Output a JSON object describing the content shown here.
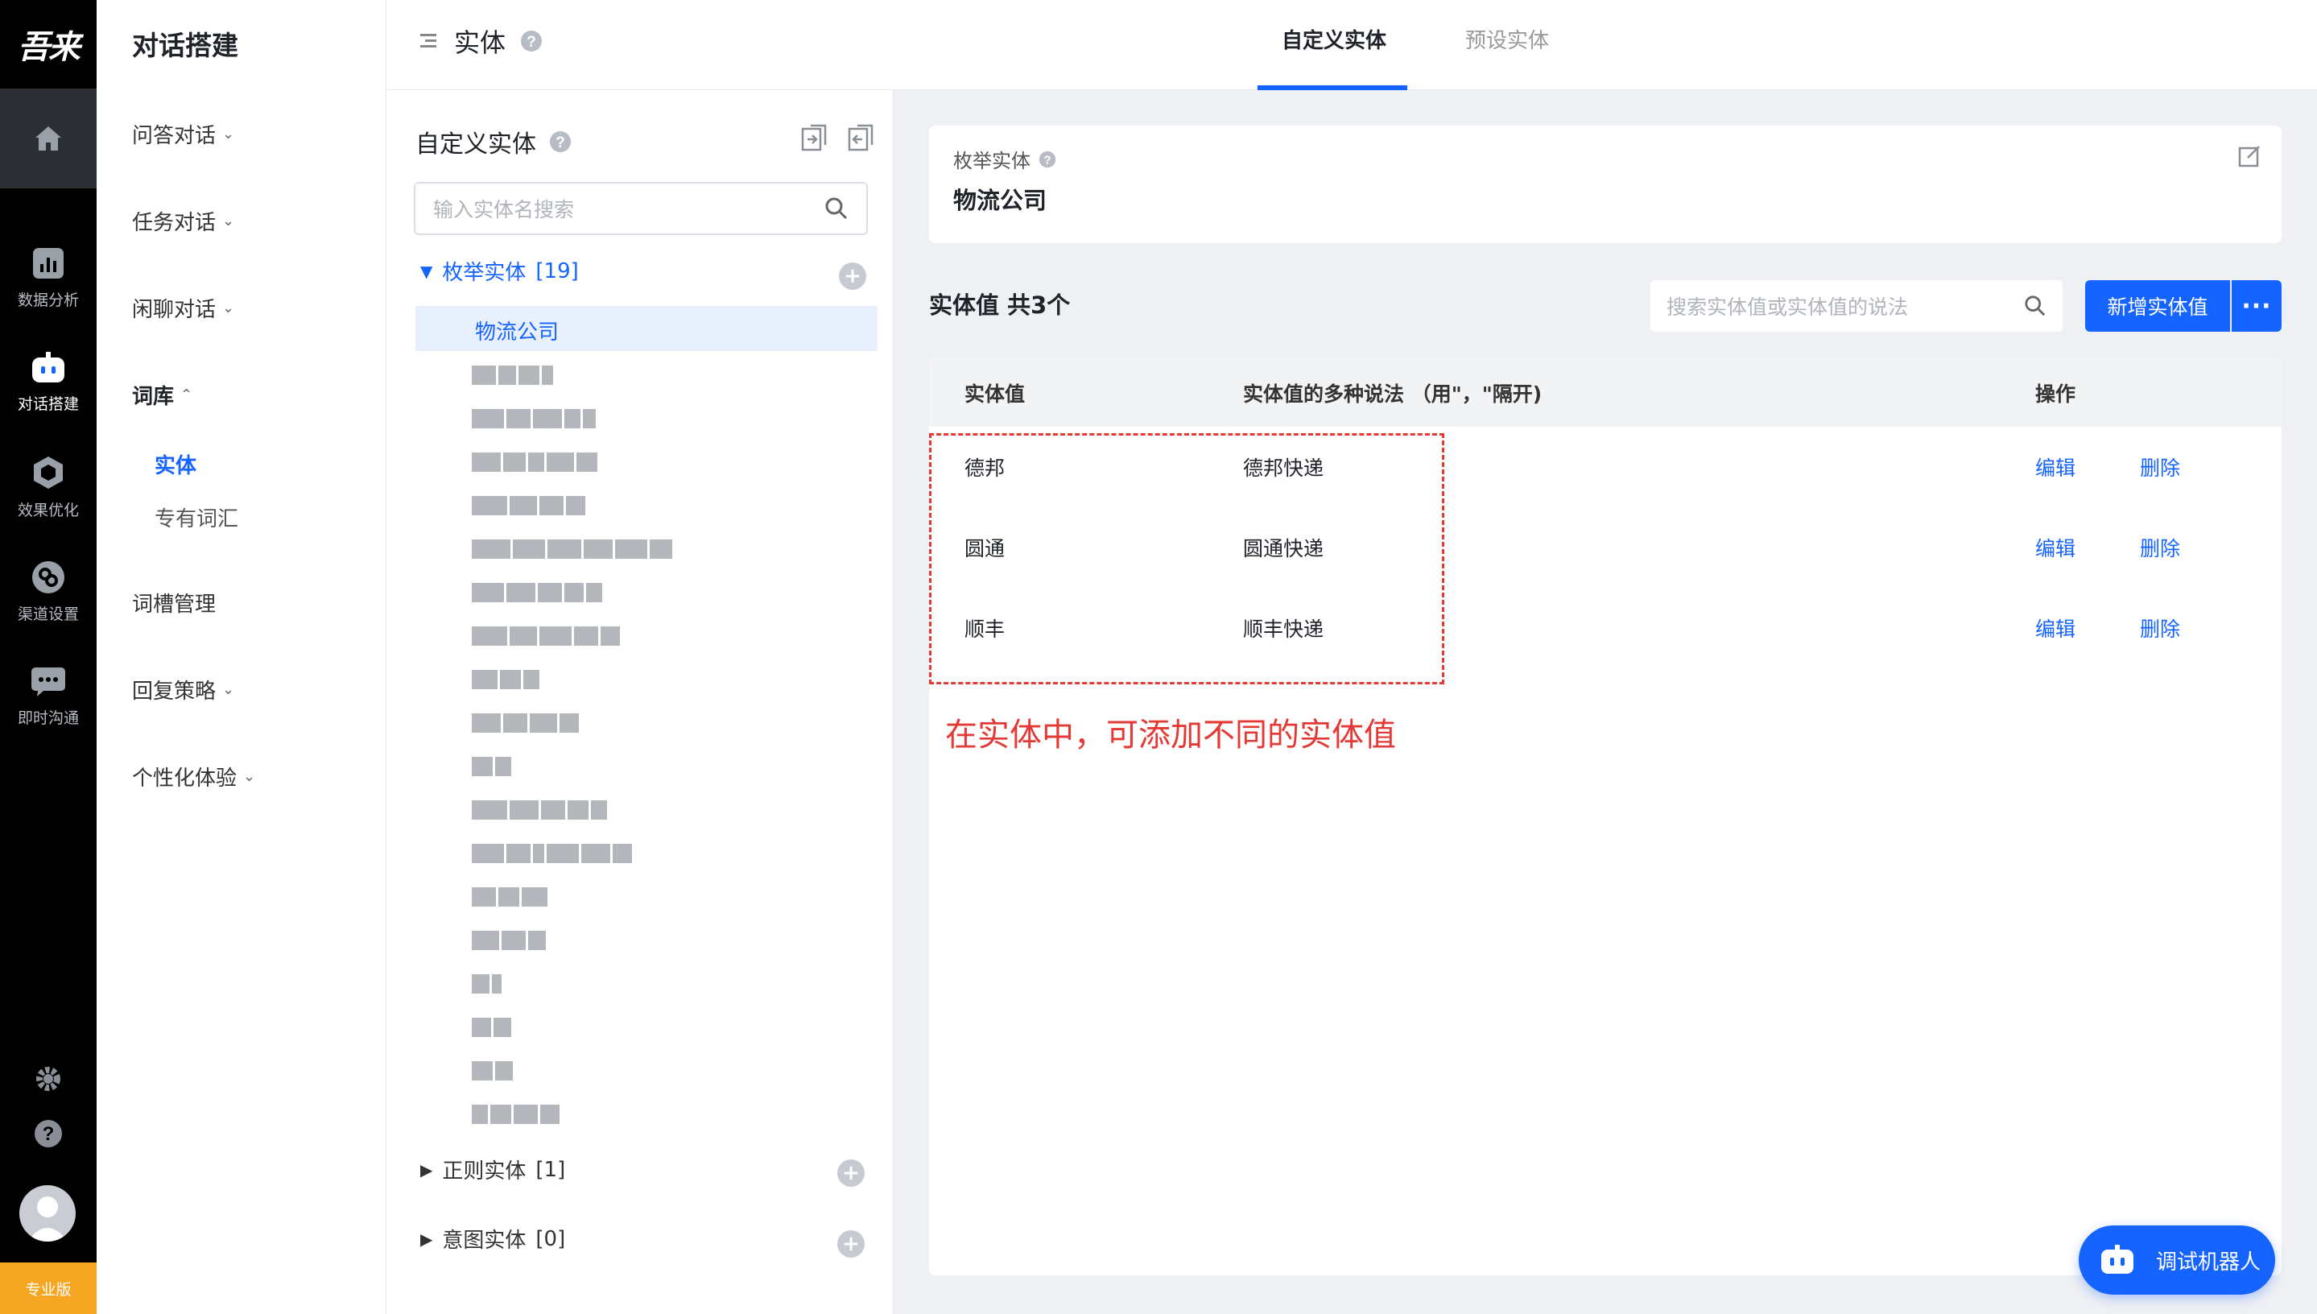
{
  "rail": {
    "logo": "吾来",
    "items": [
      {
        "label": "数据分析",
        "icon": "bar-chart-icon"
      },
      {
        "label": "对话搭建",
        "icon": "robot-icon"
      },
      {
        "label": "效果优化",
        "icon": "cube-icon"
      },
      {
        "label": "渠道设置",
        "icon": "link-icon"
      },
      {
        "label": "即时沟通",
        "icon": "chat-icon"
      }
    ],
    "badge": "专业版"
  },
  "nav": {
    "title": "对话搭建",
    "items": [
      {
        "label": "问答对话"
      },
      {
        "label": "任务对话"
      },
      {
        "label": "闲聊对话"
      },
      {
        "label": "词库"
      },
      {
        "label": "词槽管理"
      },
      {
        "label": "回复策略"
      },
      {
        "label": "个性化体验"
      }
    ],
    "sub_items": [
      {
        "label": "实体"
      },
      {
        "label": "专有词汇"
      }
    ]
  },
  "header": {
    "title": "实体",
    "tabs": [
      {
        "label": "自定义实体"
      },
      {
        "label": "预设实体"
      }
    ]
  },
  "entity_panel": {
    "title": "自定义实体",
    "search_placeholder": "输入实体名搜索",
    "groups": [
      {
        "label": "枚举实体",
        "count": "[19]"
      },
      {
        "label": "正则实体",
        "count": "[1]"
      },
      {
        "label": "意图实体",
        "count": "[0]"
      }
    ],
    "selected": "物流公司"
  },
  "detail": {
    "type_label": "枚举实体",
    "name": "物流公司"
  },
  "values_section": {
    "title": "实体值 共3个",
    "search_placeholder": "搜索实体值或实体值的说法",
    "add_button": "新增实体值",
    "more_button": "···"
  },
  "table": {
    "headers": {
      "value": "实体值",
      "synonyms": "实体值的多种说法 （用\"，\"隔开)",
      "actions": "操作"
    },
    "rows": [
      {
        "value": "德邦",
        "synonyms": "德邦快递",
        "edit": "编辑",
        "delete": "删除"
      },
      {
        "value": "圆通",
        "synonyms": "圆通快递",
        "edit": "编辑",
        "delete": "删除"
      },
      {
        "value": "顺丰",
        "synonyms": "顺丰快递",
        "edit": "编辑",
        "delete": "删除"
      }
    ]
  },
  "annotation": "在实体中，可添加不同的实体值",
  "debug_button": "调试机器人",
  "colors": {
    "accent": "#1664ff",
    "annotation": "#e53935",
    "rail": "#000000",
    "badge": "#f5a623"
  }
}
